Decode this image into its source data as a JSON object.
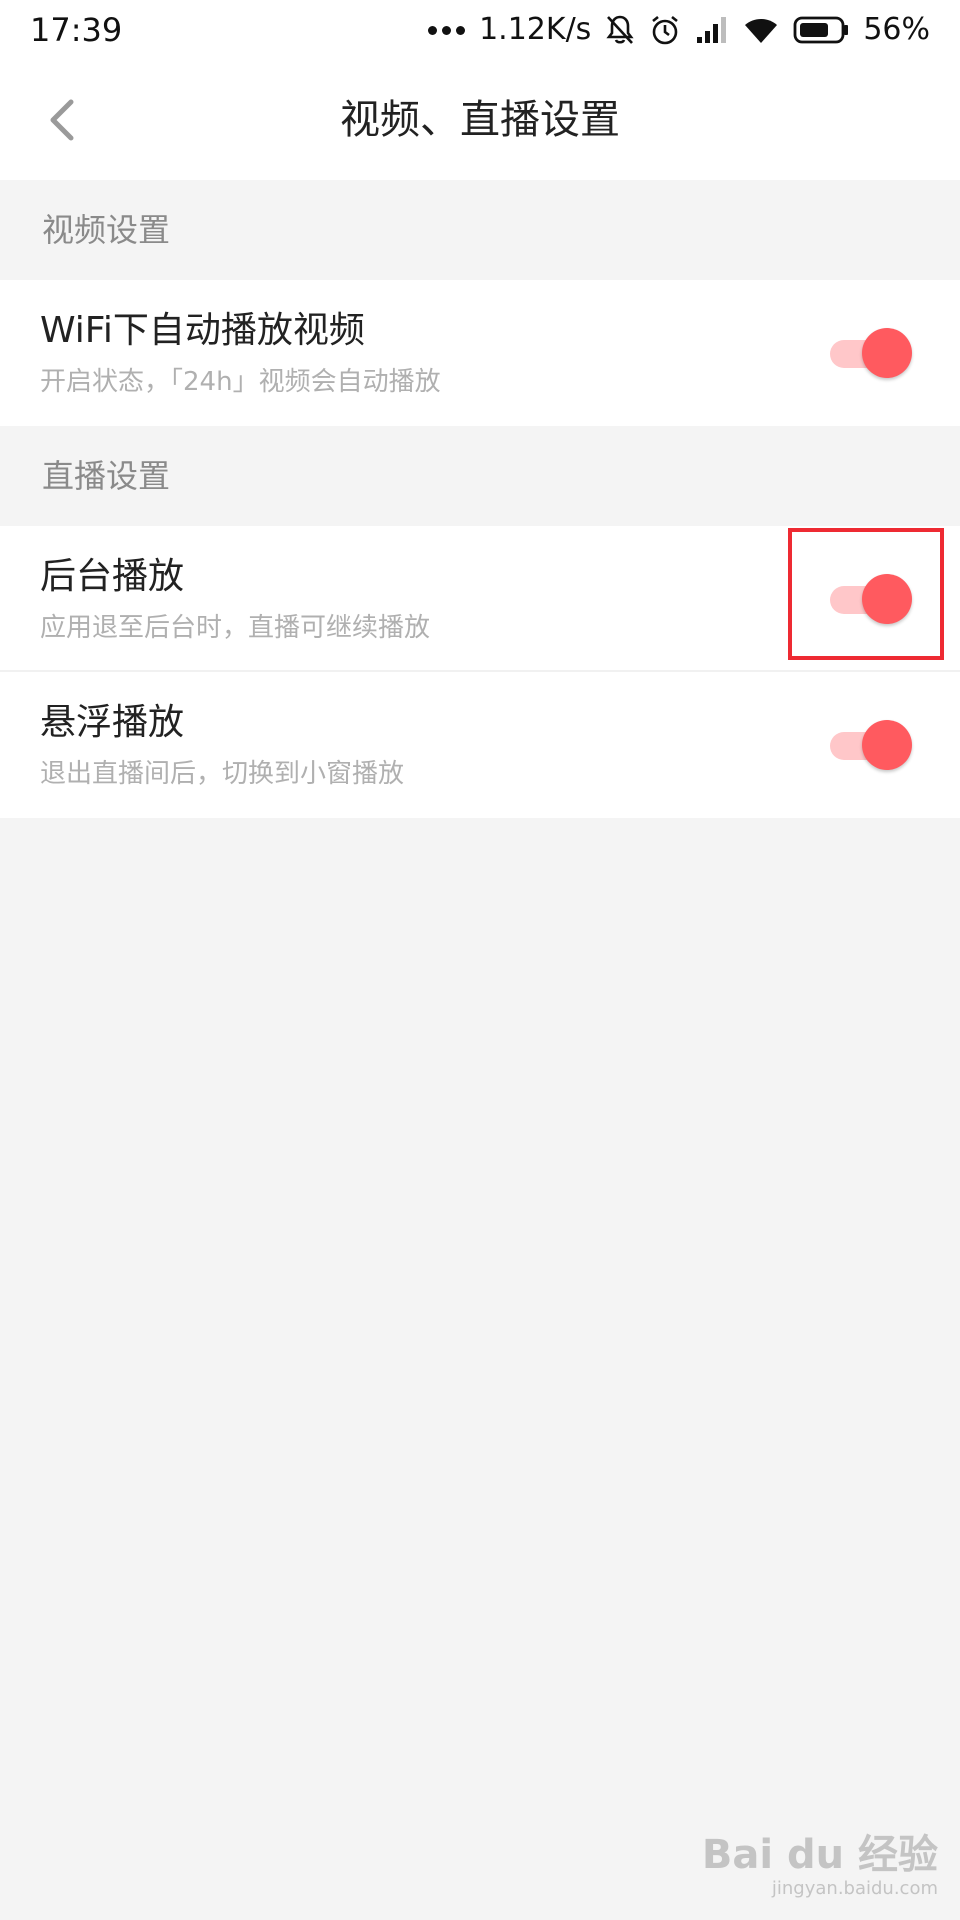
{
  "status_bar": {
    "time": "17:39",
    "net_speed": "1.12K/s",
    "battery": "56%"
  },
  "header": {
    "title": "视频、直播设置"
  },
  "sections": [
    {
      "label": "视频设置",
      "items": [
        {
          "title": "WiFi下自动播放视频",
          "description": "开启状态，「24h」视频会自动播放",
          "enabled": true
        }
      ]
    },
    {
      "label": "直播设置",
      "items": [
        {
          "title": "后台播放",
          "description": "应用退至后台时，直播可继续播放",
          "enabled": true
        },
        {
          "title": "悬浮播放",
          "description": "退出直播间后，切换到小窗播放",
          "enabled": true
        }
      ]
    }
  ],
  "watermark": {
    "main": "Bai du 经验",
    "sub": "jingyan.baidu.com"
  },
  "colors": {
    "accent": "#ff5a5f",
    "toggle_track": "#ffc7c9",
    "highlight": "#ee2a32"
  }
}
